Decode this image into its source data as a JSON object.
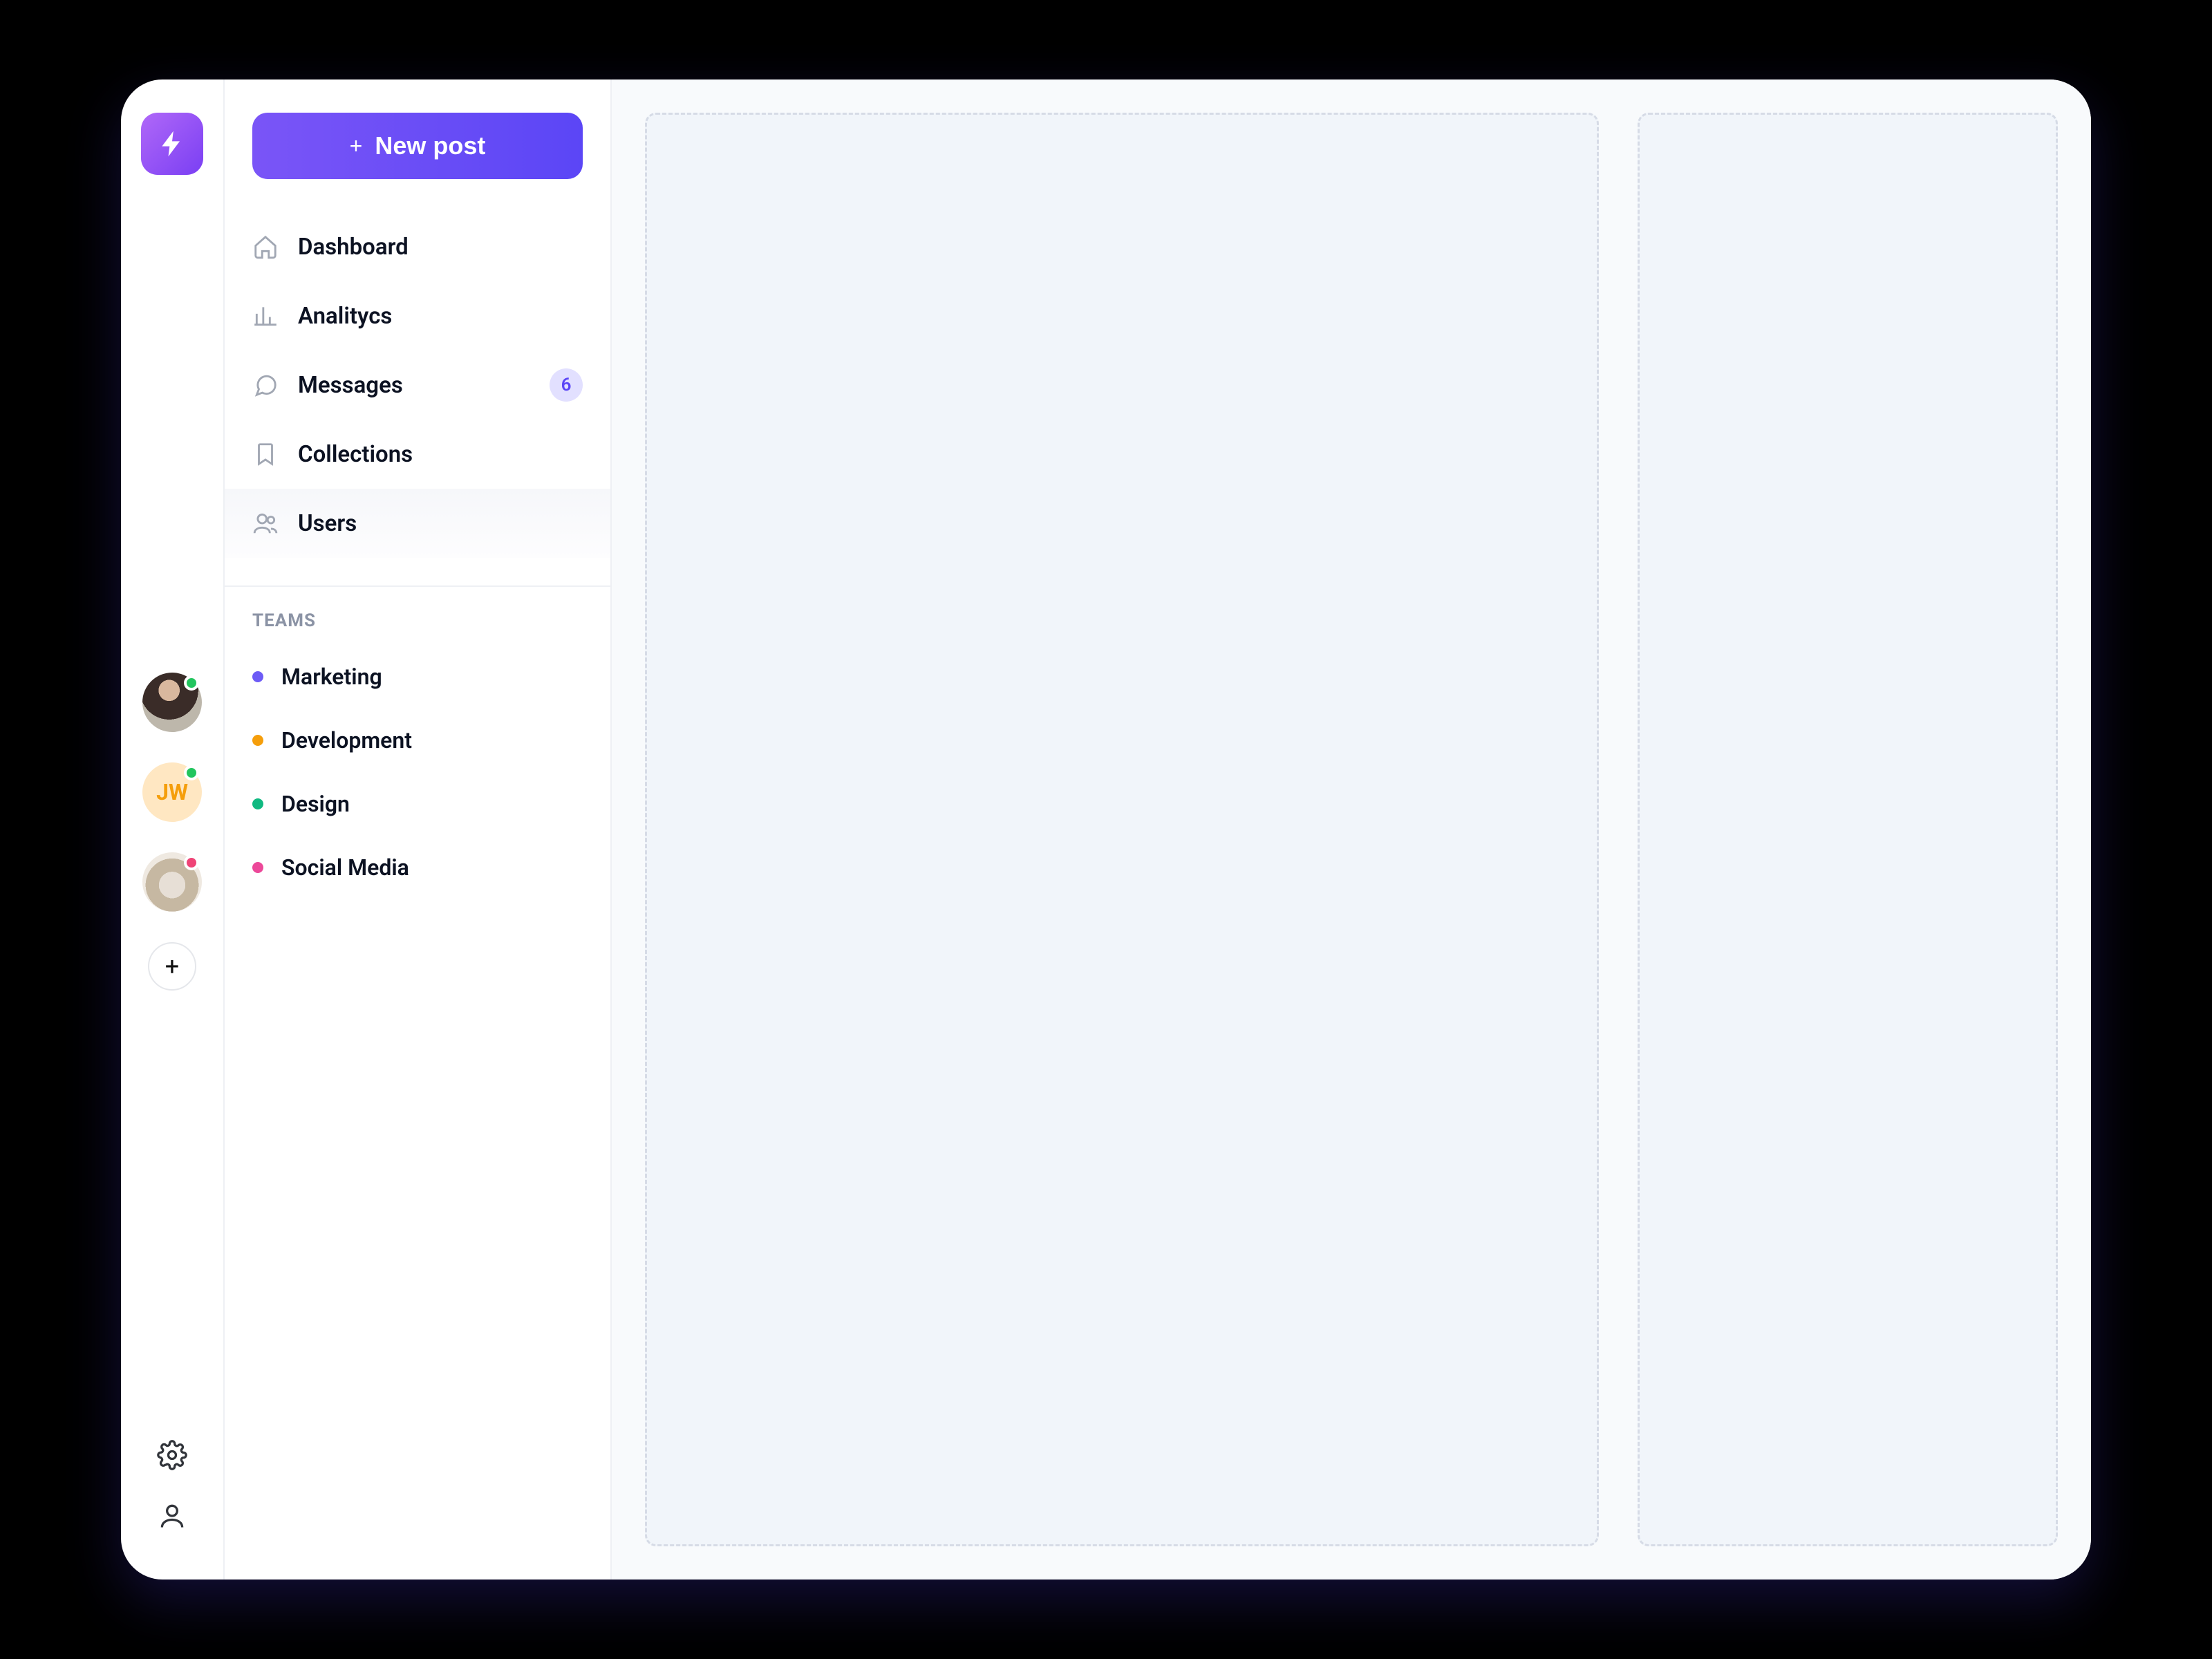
{
  "rail": {
    "avatars": [
      {
        "kind": "photo",
        "status": "online"
      },
      {
        "kind": "initials",
        "initials": "JW",
        "status": "online"
      },
      {
        "kind": "photo",
        "status": "busy"
      }
    ]
  },
  "sidebar": {
    "newPostLabel": "New post",
    "nav": [
      {
        "label": "Dashboard",
        "icon": "home"
      },
      {
        "label": "Analitycs",
        "icon": "chart"
      },
      {
        "label": "Messages",
        "icon": "chat",
        "badge": "6"
      },
      {
        "label": "Collections",
        "icon": "bookmark"
      },
      {
        "label": "Users",
        "icon": "users",
        "active": true
      }
    ],
    "teamsHeader": "TEAMS",
    "teams": [
      {
        "label": "Marketing",
        "color": "#6d5bf6"
      },
      {
        "label": "Development",
        "color": "#f59e0b"
      },
      {
        "label": "Design",
        "color": "#10b981"
      },
      {
        "label": "Social Media",
        "color": "#ec4899"
      }
    ]
  }
}
